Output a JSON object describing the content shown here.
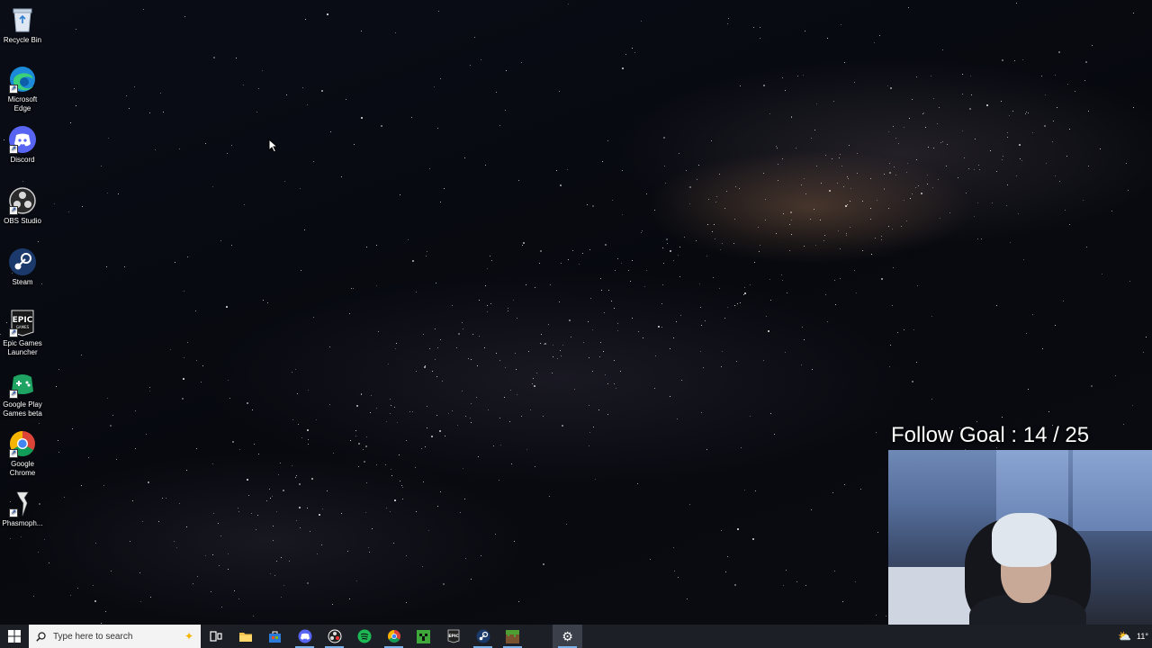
{
  "desktop_icons": [
    {
      "label": "Recycle Bin",
      "icon": "recycle-bin-icon"
    },
    {
      "label": "Microsoft Edge",
      "icon": "edge-icon"
    },
    {
      "label": "Discord",
      "icon": "discord-icon"
    },
    {
      "label": "OBS Studio",
      "icon": "obs-icon"
    },
    {
      "label": "Steam",
      "icon": "steam-icon"
    },
    {
      "label": "Epic Games Launcher",
      "icon": "epic-games-icon"
    },
    {
      "label": "Google Play Games beta",
      "icon": "google-play-games-icon"
    },
    {
      "label": "Google Chrome",
      "icon": "chrome-icon"
    },
    {
      "label": "Phasmoph...",
      "icon": "phasmophobia-icon"
    }
  ],
  "overlay": {
    "follow_goal": "Follow Goal : 14  / 25"
  },
  "taskbar": {
    "search_placeholder": "Type here to search",
    "apps": [
      {
        "name": "task-view",
        "icon": "task-view-icon"
      },
      {
        "name": "file-explorer",
        "icon": "folder-icon"
      },
      {
        "name": "store",
        "icon": "store-icon"
      },
      {
        "name": "discord",
        "icon": "discord-icon"
      },
      {
        "name": "obs",
        "icon": "obs-icon"
      },
      {
        "name": "spotify",
        "icon": "spotify-icon"
      },
      {
        "name": "chrome",
        "icon": "chrome-icon"
      },
      {
        "name": "minecraft",
        "icon": "minecraft-icon"
      },
      {
        "name": "epic-games",
        "icon": "epic-games-icon"
      },
      {
        "name": "steam",
        "icon": "steam-icon"
      },
      {
        "name": "minecraft-launcher",
        "icon": "grass-block-icon"
      },
      {
        "name": "settings",
        "icon": "gear-icon"
      }
    ],
    "weather_text": "11°"
  },
  "colors": {
    "taskbar_bg": "#1c1f26",
    "active_indicator": "#79b0e8",
    "discord": "#5865f2",
    "spotify": "#1db954",
    "chrome_red": "#db4437",
    "chrome_green": "#0f9d58",
    "chrome_yellow": "#f4b400",
    "chrome_blue": "#4285f4"
  }
}
